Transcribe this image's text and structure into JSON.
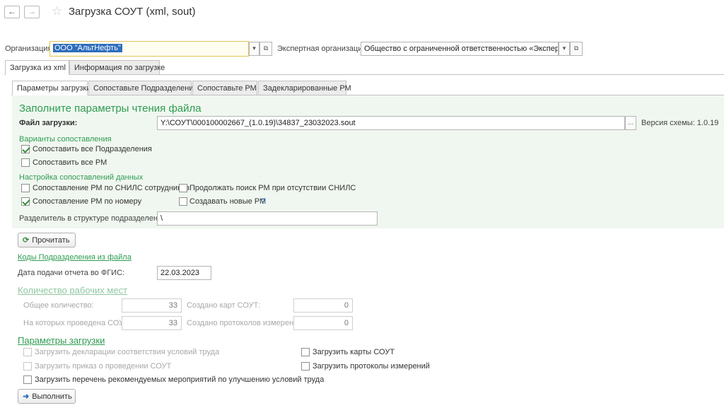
{
  "window": {
    "title": "Загрузка СОУТ (xml, sout)"
  },
  "header": {
    "org_label": "Организация:",
    "org_value": "ООО  \"АльтНефть\"",
    "expert_label": "Экспертная организация:",
    "expert_value": "Общество с ограниченной ответственностью «Экспертный ц"
  },
  "outer_tabs": [
    {
      "label": "Загрузка из xml"
    },
    {
      "label": "Информация по загрузке"
    }
  ],
  "inner_tabs": [
    {
      "label": "Параметры загрузки"
    },
    {
      "label": "Сопоставьте Подразделения"
    },
    {
      "label": "Сопоставьте РМ"
    },
    {
      "label": "Задекларированные РМ"
    }
  ],
  "params": {
    "heading": "Заполните параметры чтения файла",
    "file_label": "Файл загрузки:",
    "file_value": "Y:\\СОУТ\\000100002667_(1.0.19)\\34837_23032023.sout",
    "file_btn": "...",
    "schema_version": "Версия схемы: 1.0.19",
    "variants_heading": "Варианты сопоставления",
    "cb_all_subdivisions": "Сопоставить все Подразделения",
    "cb_all_rm": "Сопоставить все РМ",
    "settings_heading": "Настройка сопоставлений данных",
    "cb_snils": "Сопоставление РМ по СНИЛС сотрудников",
    "cb_continue_search": "Продолжать поиск РМ при отсутствии СНИЛС",
    "cb_by_number": "Сопоставление РМ по номеру",
    "cb_create_rm": "Создавать новые РМ",
    "help_mark": "?",
    "separator_label": "Разделитель в структуре подразделений:",
    "separator_value": "\\"
  },
  "read_button": "Прочитать",
  "codes_link": "Коды Подразделения из файла",
  "date_label": "Дата подачи отчета во ФГИС:",
  "date_value": "22.03.2023",
  "workplaces": {
    "heading": "Количество рабочих мест",
    "total_label": "Общее количество:",
    "total_value": "33",
    "cards_label": "Создано карт СОУТ:",
    "cards_value": "0",
    "conducted_label": "На которых проведена СОУТ:",
    "conducted_value": "33",
    "protocols_label": "Создано протоколов измерений:",
    "protocols_value": "0"
  },
  "load_params": {
    "heading": "Параметры загрузки",
    "cb_declarations": "Загрузить декларации соответствия условий труда",
    "cb_order": "Загрузить приказ о проведении СОУТ",
    "cb_measures": "Загрузить перечень рекомендуемых мероприятий по улучшению условий труда",
    "cb_cards": "Загрузить карты СОУТ",
    "cb_protocols": "Загрузить протоколы измерений"
  },
  "execute_button": "Выполнить",
  "colors": {
    "accent_green": "#2f9c52",
    "panel_bg": "#f0f7f0",
    "selection": "#2d6dbd"
  }
}
